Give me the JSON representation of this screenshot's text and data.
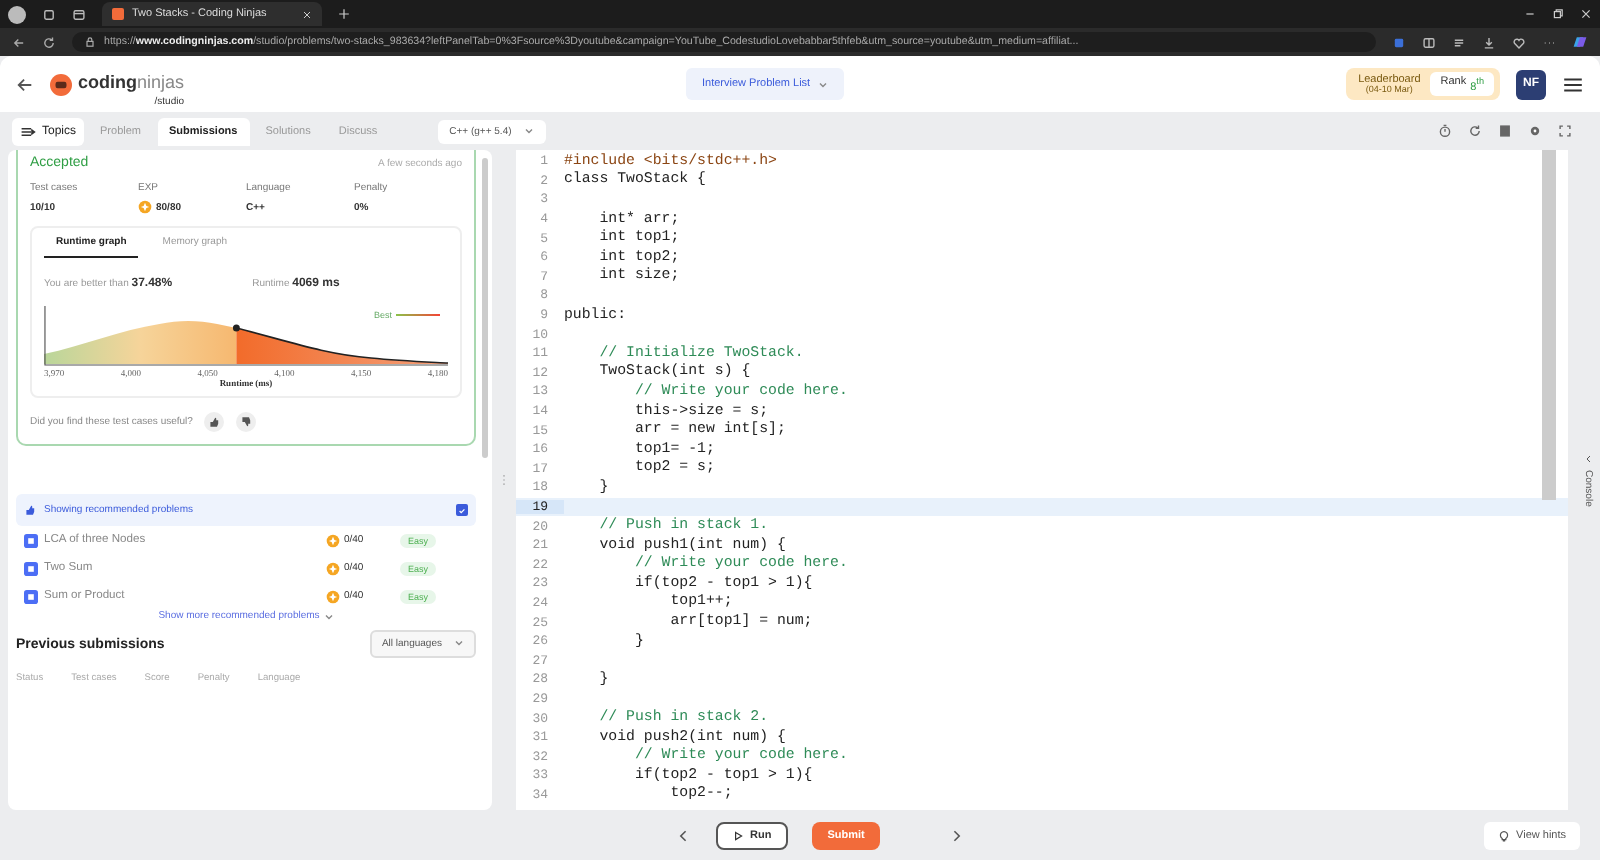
{
  "browser": {
    "tab_title": "Two Stacks - Coding Ninjas",
    "url": "https://**www.codingninjas.com**/studio/problems/two-stacks_983634?leftPanelTab=0%3Fsource%3Dyoutube&campaign=YouTube_CodestudioLovebabbar5thfeb&utm_source=youtube&utm_medium=affiliat..."
  },
  "header": {
    "logo_word": "coding",
    "logo_word_light": "ninjas",
    "logo_sub": "/studio",
    "problem_list": "Interview Problem List",
    "leaderboard": "Leaderboard",
    "leaderboard_dates": "(04-10 Mar)",
    "rank": "Rank",
    "rank_value": "8$^{th}$",
    "avatar": "NF"
  },
  "nav": {
    "topics": "Topics",
    "language": "C++ (g++ 5.4)",
    "tabs": [
      {
        "label": "Problem",
        "selected": false
      },
      {
        "label": "Submissions",
        "selected": true
      },
      {
        "label": "Solutions",
        "selected": false
      },
      {
        "label": "Discuss",
        "selected": false
      }
    ]
  },
  "submission": {
    "status": "Accepted",
    "time": "A few seconds ago",
    "stats": [
      {
        "label": "Test cases",
        "value": "10/10",
        "kind": "plain"
      },
      {
        "label": "EXP",
        "value": "80/80",
        "kind": "coin"
      },
      {
        "label": "Language",
        "value": "C++",
        "kind": "plain"
      },
      {
        "label": "Penalty",
        "value": "0%",
        "kind": "plain"
      }
    ],
    "graph_tabs": [
      {
        "label": "Runtime graph",
        "selected": true
      },
      {
        "label": "Memory graph",
        "selected": false
      }
    ],
    "better_than": "You are better than **37.48%**",
    "runtime_label": "Runtime",
    "runtime_value": "4069 ms",
    "legend": "Best",
    "x_ticks": [
      "3,970",
      "4,000",
      "4,050",
      "4,100",
      "4,150",
      "4,180"
    ],
    "x_label": "Runtime (ms)",
    "feedback": "Did you find these test cases useful?"
  },
  "recommended": {
    "label": "Showing recommended problems",
    "checked": true,
    "show_more": "Show more recommended problems",
    "problems": [
      {
        "title": "LCA of three Nodes",
        "score": "0/40",
        "difficulty": "Easy"
      },
      {
        "title": "Two Sum",
        "score": "0/40",
        "difficulty": "Easy"
      },
      {
        "title": "Sum or Product",
        "score": "0/40",
        "difficulty": "Easy"
      }
    ]
  },
  "previous": {
    "title": "Previous submissions",
    "filter": "All languages",
    "columns": [
      "Status",
      "Test cases",
      "Score",
      "Penalty",
      "Language"
    ]
  },
  "editor": {
    "lines": [
      {
        "n": "1",
        "text": "#include <bits/stdc++.h>",
        "kind": "directive",
        "current": false
      },
      {
        "n": "2",
        "text": "class TwoStack {",
        "kind": "code",
        "current": false
      },
      {
        "n": "3",
        "current": false
      },
      {
        "n": "4",
        "text": "    int* arr;",
        "kind": "code",
        "current": false
      },
      {
        "n": "5",
        "text": "    int top1;",
        "kind": "code",
        "current": false
      },
      {
        "n": "6",
        "text": "    int top2;",
        "kind": "code",
        "current": false
      },
      {
        "n": "7",
        "text": "    int size;",
        "kind": "code",
        "current": false
      },
      {
        "n": "8",
        "current": false
      },
      {
        "n": "9",
        "text": "public:",
        "kind": "code",
        "current": false
      },
      {
        "n": "10",
        "current": false
      },
      {
        "n": "11",
        "text": "    // Initialize TwoStack.",
        "kind": "comment",
        "current": false
      },
      {
        "n": "12",
        "text": "    TwoStack(int s) {",
        "kind": "code",
        "current": false
      },
      {
        "n": "13",
        "text": "        // Write your code here.",
        "kind": "comment",
        "current": false
      },
      {
        "n": "14",
        "text": "        this->size = s;",
        "kind": "code",
        "current": false
      },
      {
        "n": "15",
        "text": "        arr = new int[s];",
        "kind": "code",
        "current": false
      },
      {
        "n": "16",
        "text": "        top1= -1;",
        "kind": "code",
        "current": false
      },
      {
        "n": "17",
        "text": "        top2 = s;",
        "kind": "code",
        "current": false
      },
      {
        "n": "18",
        "text": "    }",
        "kind": "code",
        "current": false
      },
      {
        "n": "19",
        "current": true
      },
      {
        "n": "20",
        "text": "    // Push in stack 1.",
        "kind": "comment",
        "current": false
      },
      {
        "n": "21",
        "text": "    void push1(int num) {",
        "kind": "code",
        "current": false
      },
      {
        "n": "22",
        "text": "        // Write your code here.",
        "kind": "comment",
        "current": false
      },
      {
        "n": "23",
        "text": "        if(top2 - top1 > 1){",
        "kind": "code",
        "current": false
      },
      {
        "n": "24",
        "text": "            top1++;",
        "kind": "code",
        "current": false
      },
      {
        "n": "25",
        "text": "            arr[top1] = num;",
        "kind": "code",
        "current": false
      },
      {
        "n": "26",
        "text": "        }",
        "kind": "code",
        "current": false
      },
      {
        "n": "27",
        "current": false
      },
      {
        "n": "28",
        "text": "    }",
        "kind": "code",
        "current": false
      },
      {
        "n": "29",
        "current": false
      },
      {
        "n": "30",
        "text": "    // Push in stack 2.",
        "kind": "comment",
        "current": false
      },
      {
        "n": "31",
        "text": "    void push2(int num) {",
        "kind": "code",
        "current": false
      },
      {
        "n": "32",
        "text": "        // Write your code here.",
        "kind": "comment",
        "current": false
      },
      {
        "n": "33",
        "text": "        if(top2 - top1 > 1){",
        "kind": "code",
        "current": false
      },
      {
        "n": "34",
        "text": "            top2--;",
        "kind": "code",
        "current": false
      }
    ]
  },
  "footer": {
    "run": "Run",
    "submit": "Submit",
    "hints": "View hints",
    "console": "Console"
  }
}
